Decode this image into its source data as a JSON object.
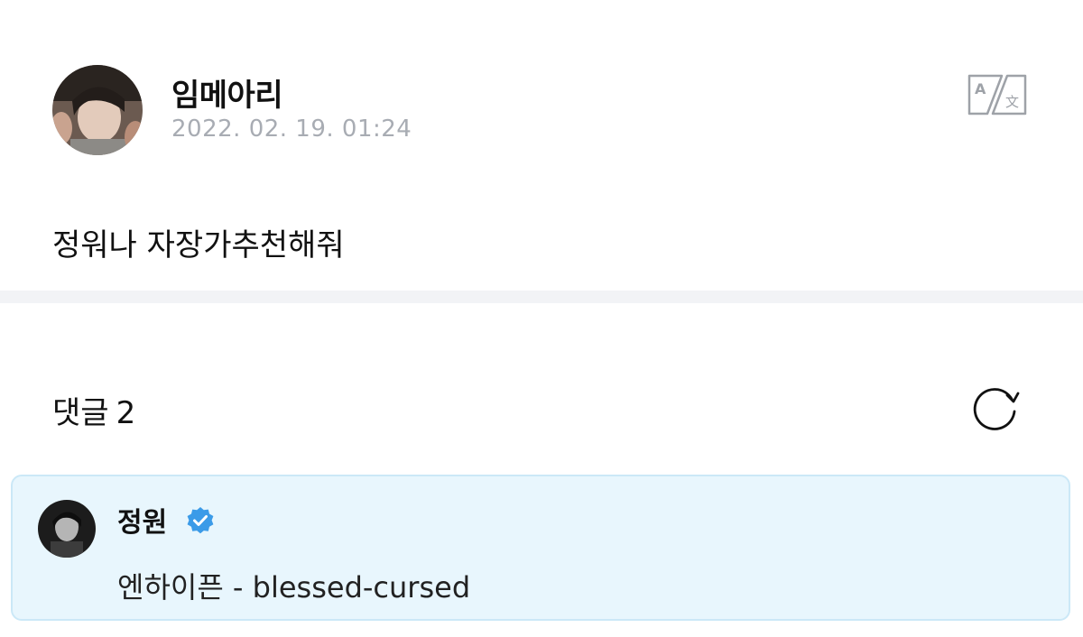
{
  "post": {
    "author": "임메아리",
    "date": "2022. 02. 19. 01:24",
    "body": "정워나 자장가추천해줘",
    "translate_icon": "translate-icon"
  },
  "comments": {
    "title": "댓글",
    "count": "2",
    "refresh_icon": "refresh-icon",
    "items": [
      {
        "author": "정원",
        "verified": true,
        "text": "엔하이픈 - blessed-cursed"
      }
    ]
  },
  "colors": {
    "text": "#111111",
    "muted": "#a8acb3",
    "comment_bg": "#e8f6fd",
    "comment_border": "#cbe8f7",
    "verified": "#3b9be8",
    "divider": "#f2f3f6"
  }
}
